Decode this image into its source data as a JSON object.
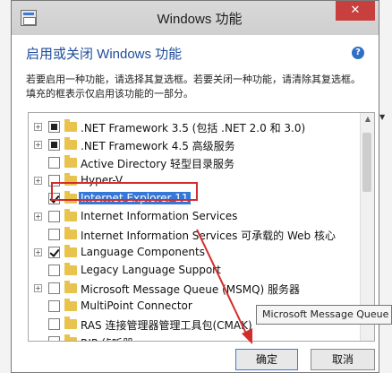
{
  "window": {
    "title": "Windows 功能",
    "close_glyph": "✕"
  },
  "heading": "启用或关闭 Windows 功能",
  "help_glyph": "?",
  "description": "若要启用一种功能，请选择其复选框。若要关闭一种功能，请清除其复选框。填充的框表示仅启用该功能的一部分。",
  "features": [
    {
      "label": ".NET Framework 3.5 (包括 .NET 2.0 和 3.0)",
      "expandable": true,
      "state": "partial"
    },
    {
      "label": ".NET Framework 4.5 高级服务",
      "expandable": true,
      "state": "partial"
    },
    {
      "label": "Active Directory 轻型目录服务",
      "expandable": false,
      "state": "unchecked"
    },
    {
      "label": "Hyper-V",
      "expandable": true,
      "state": "unchecked"
    },
    {
      "label": "Internet Explorer 11",
      "expandable": false,
      "state": "checked",
      "selected": true
    },
    {
      "label": "Internet Information Services",
      "expandable": true,
      "state": "unchecked"
    },
    {
      "label": "Internet Information Services 可承载的 Web 核心",
      "expandable": false,
      "state": "unchecked"
    },
    {
      "label": "Language Components",
      "expandable": true,
      "state": "checked"
    },
    {
      "label": "Legacy Language Support",
      "expandable": false,
      "state": "unchecked"
    },
    {
      "label": "Microsoft Message Queue (MSMQ) 服务器",
      "expandable": true,
      "state": "unchecked"
    },
    {
      "label": "MultiPoint Connector",
      "expandable": false,
      "state": "unchecked"
    },
    {
      "label": "RAS 连接管理器管理工具包(CMAK)",
      "expandable": false,
      "state": "unchecked"
    },
    {
      "label": "RIP 侦听器",
      "expandable": false,
      "state": "unchecked"
    }
  ],
  "tooltip": "Microsoft Message Queue",
  "buttons": {
    "ok": "确定",
    "cancel": "取消"
  },
  "colors": {
    "selection": "#3578d8",
    "highlight_box": "#d42c2c",
    "arrow": "#d42c2c",
    "heading": "#1d4c9c"
  }
}
